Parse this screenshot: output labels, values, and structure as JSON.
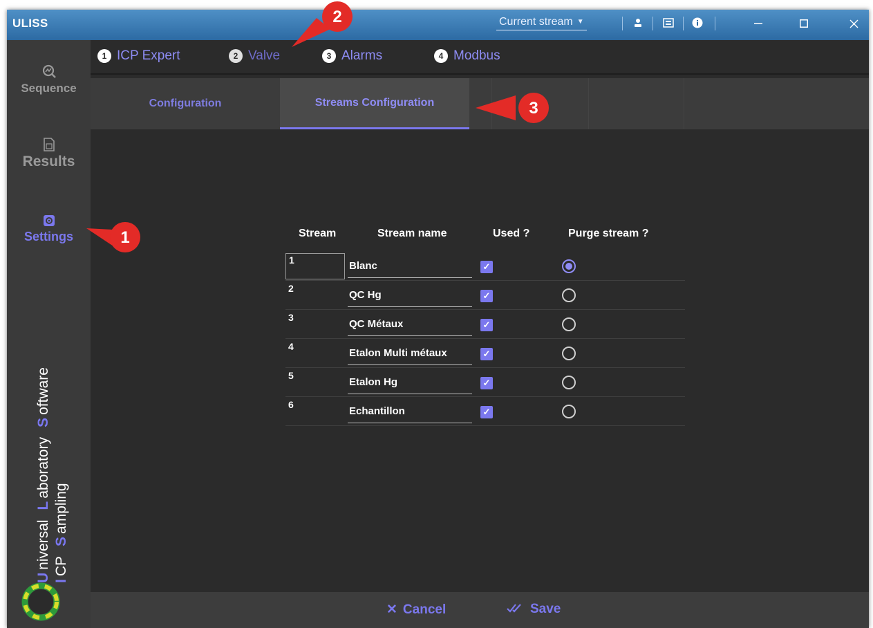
{
  "window": {
    "title": "ULISS",
    "stream_selector": "Current stream",
    "controls": [
      "minimize",
      "maximize",
      "close"
    ]
  },
  "sidebar": {
    "items": [
      {
        "label": "Sequence",
        "icon": "chart-search-icon"
      },
      {
        "label": "Results",
        "icon": "document-icon"
      },
      {
        "label": "Settings",
        "icon": "settings-icon",
        "active": true
      }
    ],
    "brand_line1": {
      "U": "U",
      "niversal": "niversal",
      "L": "L",
      "aboratory": "aboratory",
      "S": "S",
      "oftware": "oftware"
    },
    "brand_line2": {
      "I": "I",
      "CP": "CP",
      "S": "S",
      "ampling": "ampling"
    }
  },
  "steps": [
    {
      "num": "1",
      "label": "ICP Expert"
    },
    {
      "num": "2",
      "label": "Valve",
      "active": true
    },
    {
      "num": "3",
      "label": "Alarms"
    },
    {
      "num": "4",
      "label": "Modbus"
    }
  ],
  "subtabs": [
    {
      "label": "Configuration"
    },
    {
      "label": "Streams Configuration",
      "active": true
    }
  ],
  "table": {
    "headers": [
      "Stream",
      "Stream name",
      "Used ?",
      "Purge stream ?"
    ],
    "rows": [
      {
        "stream": "1",
        "name": "Blanc",
        "used": true,
        "purge": true
      },
      {
        "stream": "2",
        "name": "QC Hg",
        "used": true,
        "purge": false
      },
      {
        "stream": "3",
        "name": "QC Métaux",
        "used": true,
        "purge": false
      },
      {
        "stream": "4",
        "name": "Etalon Multi métaux",
        "used": true,
        "purge": false
      },
      {
        "stream": "5",
        "name": "Etalon Hg",
        "used": true,
        "purge": false
      },
      {
        "stream": "6",
        "name": "Echantillon",
        "used": true,
        "purge": false
      }
    ]
  },
  "footer": {
    "cancel": "Cancel",
    "save": "Save"
  },
  "callouts": [
    "1",
    "2",
    "3"
  ],
  "colors": {
    "accent": "#7b78ee",
    "callout": "#e32b27",
    "titlebar": "#3f7fbb"
  }
}
